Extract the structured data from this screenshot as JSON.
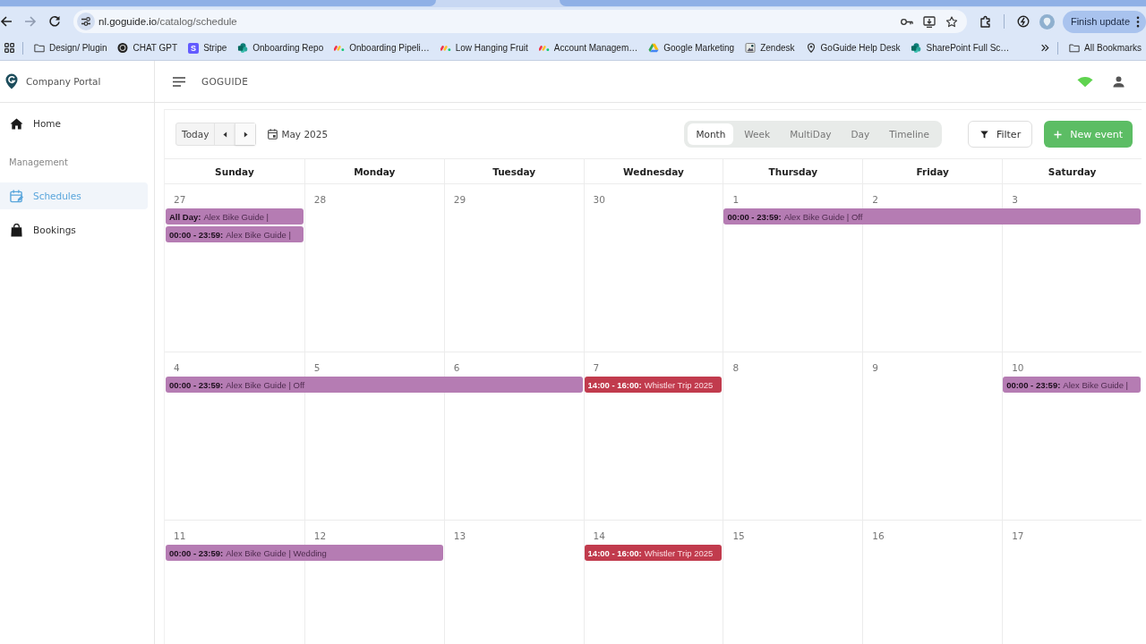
{
  "browser": {
    "back": {
      "disabled": false
    },
    "forward": {
      "disabled": true
    },
    "address": {
      "host": "nl.goguide.io",
      "path": "/catalog/schedule"
    },
    "update_button": "Finish update",
    "bookmarks": [
      {
        "kind": "folder",
        "label": "Design/ Plugin"
      },
      {
        "kind": "ring",
        "label": "CHAT GPT"
      },
      {
        "kind": "letter",
        "badge": "S",
        "label": "Stripe"
      },
      {
        "kind": "dots",
        "label": "Onboarding Repo"
      },
      {
        "kind": "stripes",
        "label": "Onboarding Pipeli…"
      },
      {
        "kind": "stripes",
        "label": "Low Hanging Fruit"
      },
      {
        "kind": "stripes",
        "label": "Account Managem…"
      },
      {
        "kind": "triangle",
        "label": "Google Marketing"
      },
      {
        "kind": "tile",
        "label": "Zendesk"
      },
      {
        "kind": "pin",
        "label": "GoGuide Help Desk"
      },
      {
        "kind": "dots",
        "label": "SharePoint Full Sc…"
      }
    ],
    "all_bookmarks": "All Bookmarks"
  },
  "sidebar": {
    "brand": "Company Portal",
    "items": [
      {
        "kind": "link",
        "label": "Home",
        "selected": false
      },
      {
        "kind": "heading",
        "label": "Management"
      },
      {
        "kind": "link",
        "label": "Schedules",
        "selected": true
      },
      {
        "kind": "link",
        "label": "Bookings",
        "selected": false
      }
    ]
  },
  "header": {
    "title": "GOGUIDE"
  },
  "calendar": {
    "today": "Today",
    "period": "May 2025",
    "views": [
      {
        "label": "Month",
        "selected": true
      },
      {
        "label": "Week",
        "selected": false
      },
      {
        "label": "MultiDay",
        "selected": false
      },
      {
        "label": "Day",
        "selected": false
      },
      {
        "label": "Timeline",
        "selected": false
      }
    ],
    "filter": "Filter",
    "new_event": "New event",
    "weekdays": [
      "Sunday",
      "Monday",
      "Tuesday",
      "Wednesday",
      "Thursday",
      "Friday",
      "Saturday"
    ],
    "weeks": [
      {
        "days": [
          "27",
          "28",
          "29",
          "30",
          "1",
          "2",
          "3"
        ],
        "lanes": [
          [
            {
              "kind": "event",
              "time": "All Day:",
              "title": "Alex Bike Guide |",
              "color": "#b57cb3"
            },
            {
              "kind": "empty"
            },
            {
              "kind": "empty"
            },
            {
              "kind": "empty"
            },
            {
              "kind": "event",
              "time": "00:00 - 23:59:",
              "title": "Alex Bike Guide | Off",
              "color": "#b57cb3"
            },
            {
              "kind": "continued"
            },
            {
              "kind": "continued"
            }
          ],
          [
            {
              "kind": "event",
              "time": "00:00 - 23:59:",
              "title": "Alex Bike Guide |",
              "color": "#b57cb3"
            },
            {
              "kind": "empty"
            },
            {
              "kind": "empty"
            },
            {
              "kind": "empty"
            },
            {
              "kind": "empty"
            },
            {
              "kind": "empty"
            },
            {
              "kind": "empty"
            }
          ]
        ]
      },
      {
        "days": [
          "4",
          "5",
          "6",
          "7",
          "8",
          "9",
          "10"
        ],
        "lanes": [
          [
            {
              "kind": "event",
              "time": "00:00 - 23:59:",
              "title": "Alex Bike Guide | Off",
              "color": "#b57cb3"
            },
            {
              "kind": "continued"
            },
            {
              "kind": "continued"
            },
            {
              "kind": "event",
              "time": "14:00 - 16:00:",
              "title": "Whistler Trip 2025",
              "color": "#c13b4d"
            },
            {
              "kind": "empty"
            },
            {
              "kind": "empty"
            },
            {
              "kind": "event",
              "time": "00:00 - 23:59:",
              "title": "Alex Bike Guide |",
              "color": "#b57cb3"
            }
          ]
        ]
      },
      {
        "days": [
          "11",
          "12",
          "13",
          "14",
          "15",
          "16",
          "17"
        ],
        "lanes": [
          [
            {
              "kind": "event",
              "time": "00:00 - 23:59:",
              "title": "Alex Bike Guide | Wedding",
              "color": "#b57cb3"
            },
            {
              "kind": "continued"
            },
            {
              "kind": "empty"
            },
            {
              "kind": "event",
              "time": "14:00 - 16:00:",
              "title": "Whistler Trip 2025",
              "color": "#c13b4d"
            },
            {
              "kind": "empty"
            },
            {
              "kind": "empty"
            },
            {
              "kind": "empty"
            }
          ]
        ]
      }
    ]
  }
}
